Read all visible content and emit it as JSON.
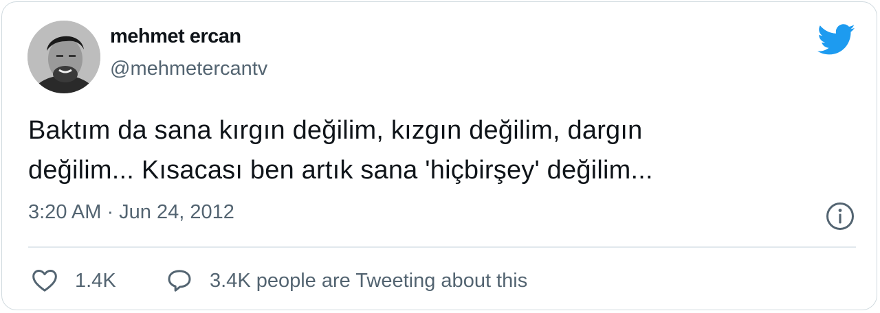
{
  "author": {
    "name": "mehmet ercan",
    "handle": "@mehmetercantv"
  },
  "tweet": {
    "text_line1": "Baktım da sana kırgın değilim, kızgın değilim, dargın",
    "text_line2": "değilim... Kısacası ben artık sana 'hiçbirşey' değilim...",
    "timestamp": "3:20 AM · Jun 24, 2012"
  },
  "actions": {
    "likes": "1.4K",
    "discussion": "3.4K people are Tweeting about this"
  },
  "icons": {
    "brand": "twitter-bird-icon",
    "info": "info-icon",
    "like": "heart-icon",
    "reply": "speech-bubble-icon"
  },
  "colors": {
    "brand": "#1d9bf0",
    "text": "#0f1419",
    "secondary": "#536471",
    "border": "#cfd9de"
  }
}
